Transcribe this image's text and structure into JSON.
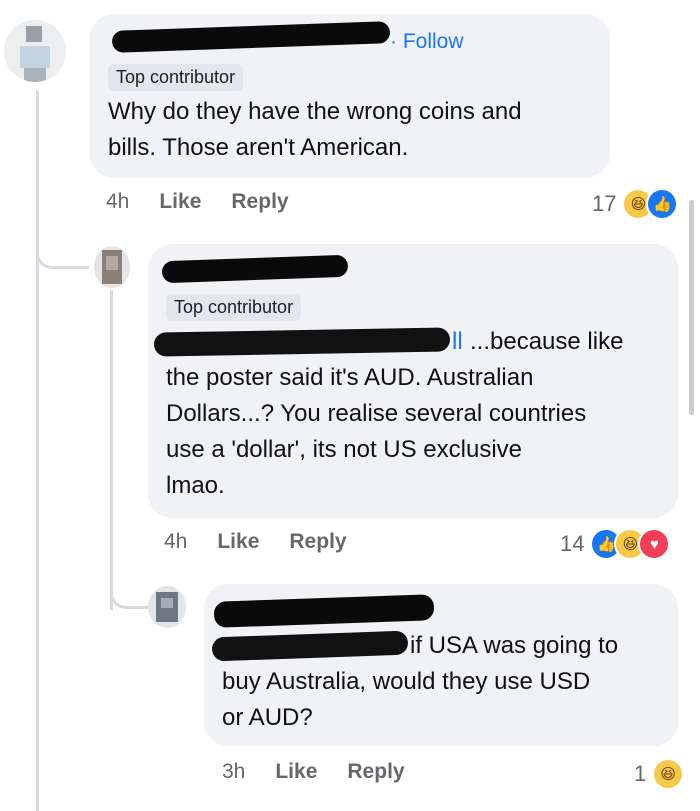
{
  "comments": [
    {
      "follow_label": "· Follow",
      "badge": "Top contributor",
      "text_lines": [
        "Why do they have the wrong coins and",
        "bills. Those aren't American."
      ],
      "time": "4h",
      "like_label": "Like",
      "reply_label": "Reply",
      "reaction_count": "17",
      "reactions": [
        "haha-icon",
        "like-icon"
      ]
    },
    {
      "badge": "Top contributor",
      "mention_fragment": "ll",
      "text_lines": [
        " ...because like",
        "the poster said it's AUD. Australian",
        "Dollars...? You realise several countries",
        "use a 'dollar', its not US exclusive",
        "lmao."
      ],
      "time": "4h",
      "like_label": "Like",
      "reply_label": "Reply",
      "reaction_count": "14",
      "reactions": [
        "like-icon",
        "haha-icon",
        "love-icon"
      ]
    },
    {
      "text_lines": [
        "if USA was going to",
        "buy Australia, would they use USD",
        "or AUD?"
      ],
      "time": "3h",
      "like_label": "Like",
      "reply_label": "Reply",
      "reaction_count": "1",
      "reactions": [
        "haha-icon"
      ]
    }
  ],
  "colors": {
    "link": "#1877f2",
    "bubble": "#f0f2f5",
    "muted": "#65676b"
  }
}
